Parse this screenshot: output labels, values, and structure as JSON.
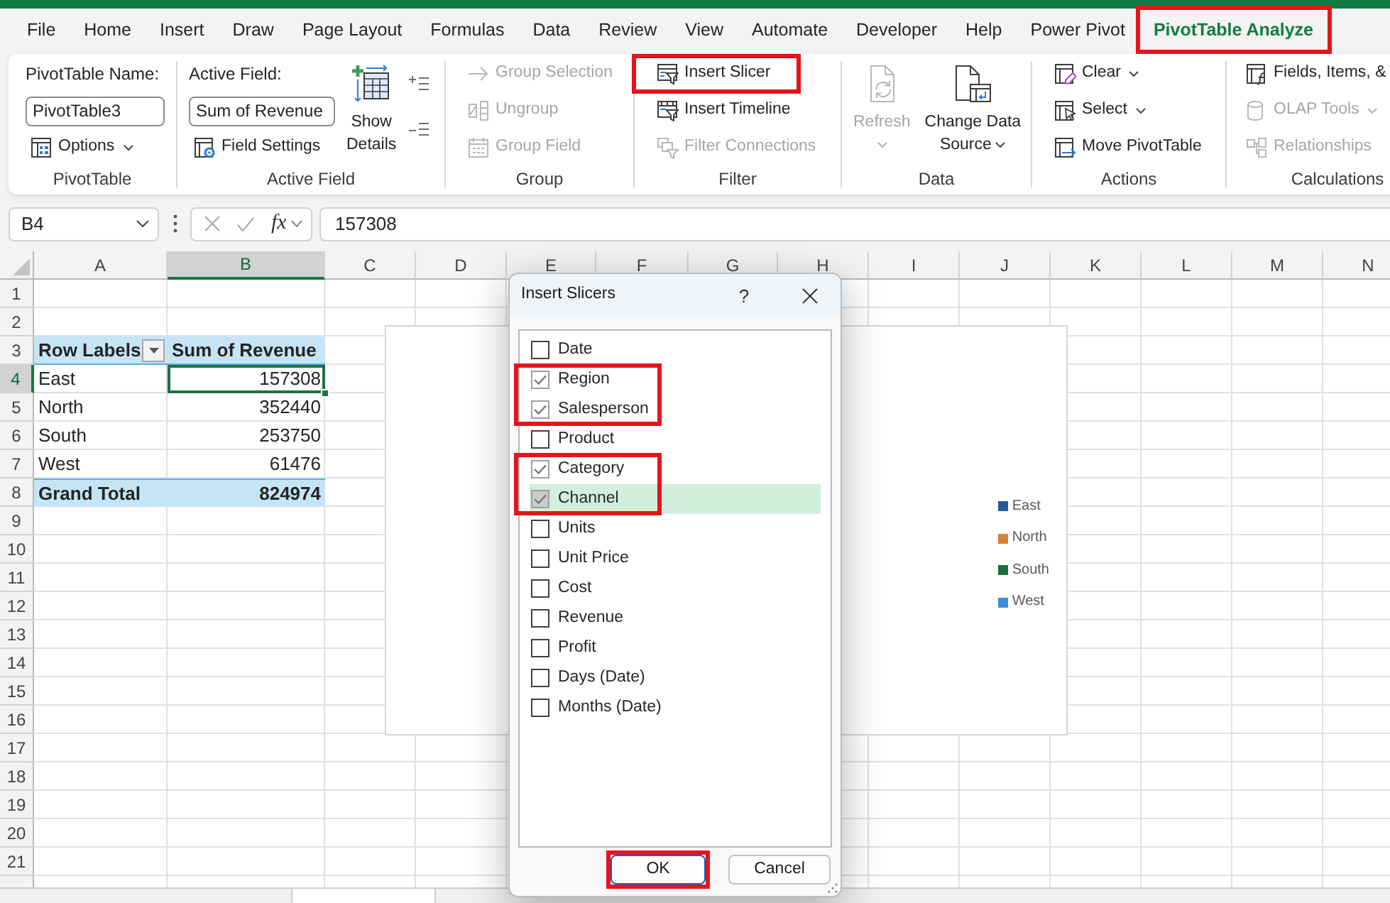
{
  "menu_tabs": [
    {
      "label": "File",
      "selected": false,
      "highlighted": false
    },
    {
      "label": "Home",
      "selected": false,
      "highlighted": false
    },
    {
      "label": "Insert",
      "selected": false,
      "highlighted": false
    },
    {
      "label": "Draw",
      "selected": false,
      "highlighted": false
    },
    {
      "label": "Page Layout",
      "selected": false,
      "highlighted": false
    },
    {
      "label": "Formulas",
      "selected": false,
      "highlighted": false
    },
    {
      "label": "Data",
      "selected": false,
      "highlighted": false
    },
    {
      "label": "Review",
      "selected": false,
      "highlighted": false
    },
    {
      "label": "View",
      "selected": false,
      "highlighted": false
    },
    {
      "label": "Automate",
      "selected": false,
      "highlighted": false
    },
    {
      "label": "Developer",
      "selected": false,
      "highlighted": false
    },
    {
      "label": "Help",
      "selected": false,
      "highlighted": false
    },
    {
      "label": "Power Pivot",
      "selected": false,
      "highlighted": false
    },
    {
      "label": "PivotTable Analyze",
      "selected": true,
      "highlighted": true
    }
  ],
  "ribbon": {
    "groups": [
      {
        "label": "PivotTable",
        "columns": [
          [
            {
              "kind": "field",
              "label": "PivotTable Name:",
              "value": "PivotTable3",
              "disabled": false,
              "highlighted": false
            },
            {
              "kind": "small",
              "label": "Options",
              "dropdown": true,
              "disabled": false,
              "highlighted": false
            }
          ]
        ]
      },
      {
        "label": "Active Field",
        "columns": [
          [
            {
              "kind": "field",
              "label": "Active Field:",
              "value": "Sum of Revenue",
              "disabled": false,
              "highlighted": false
            },
            {
              "kind": "small",
              "label": "Field Settings",
              "dropdown": false,
              "disabled": false,
              "highlighted": false
            }
          ],
          [
            {
              "kind": "large",
              "lines": [
                "Show",
                "Details"
              ],
              "dropdown": false,
              "disabled": false,
              "highlighted": false
            }
          ],
          [
            {
              "kind": "icon",
              "disabled": false,
              "highlighted": false
            },
            {
              "kind": "icon",
              "disabled": false,
              "highlighted": false
            }
          ]
        ]
      },
      {
        "label": "Group",
        "columns": [
          [
            {
              "kind": "small",
              "label": "Group Selection",
              "dropdown": false,
              "disabled": true,
              "highlighted": false
            },
            {
              "kind": "small",
              "label": "Ungroup",
              "dropdown": false,
              "disabled": true,
              "highlighted": false
            },
            {
              "kind": "small",
              "label": "Group Field",
              "dropdown": false,
              "disabled": true,
              "highlighted": false
            }
          ]
        ]
      },
      {
        "label": "Filter",
        "columns": [
          [
            {
              "kind": "small",
              "label": "Insert Slicer",
              "dropdown": false,
              "disabled": false,
              "highlighted": true
            },
            {
              "kind": "small",
              "label": "Insert Timeline",
              "dropdown": false,
              "disabled": false,
              "highlighted": false
            },
            {
              "kind": "small",
              "label": "Filter Connections",
              "dropdown": false,
              "disabled": true,
              "highlighted": false
            }
          ]
        ]
      },
      {
        "label": "Data",
        "columns": [
          [
            {
              "kind": "large",
              "lines": [
                "Refresh"
              ],
              "dropdown": true,
              "disabled": true,
              "highlighted": false
            }
          ],
          [
            {
              "kind": "large",
              "lines": [
                "Change Data",
                "Source"
              ],
              "dropdown": true,
              "disabled": false,
              "highlighted": false
            }
          ]
        ]
      },
      {
        "label": "Actions",
        "columns": [
          [
            {
              "kind": "small",
              "label": "Clear",
              "dropdown": true,
              "disabled": false,
              "highlighted": false
            },
            {
              "kind": "small",
              "label": "Select",
              "dropdown": true,
              "disabled": false,
              "highlighted": false
            },
            {
              "kind": "small",
              "label": "Move PivotTable",
              "dropdown": false,
              "disabled": false,
              "highlighted": false
            }
          ]
        ]
      },
      {
        "label": "Calculations",
        "columns": [
          [
            {
              "kind": "small",
              "label": "Fields, Items, &",
              "dropdown": false,
              "disabled": false,
              "highlighted": false
            },
            {
              "kind": "small",
              "label": "OLAP Tools",
              "dropdown": true,
              "disabled": true,
              "highlighted": false
            },
            {
              "kind": "small",
              "label": "Relationships",
              "dropdown": false,
              "disabled": true,
              "highlighted": false
            }
          ]
        ]
      }
    ]
  },
  "formula_bar": {
    "name_box": "B4",
    "function_button": "fx",
    "value": "157308"
  },
  "sheet": {
    "columns": [
      {
        "label": "A",
        "selected": false
      },
      {
        "label": "B",
        "selected": true
      },
      {
        "label": "C",
        "selected": false
      },
      {
        "label": "D",
        "selected": false
      },
      {
        "label": "E",
        "selected": false
      },
      {
        "label": "F",
        "selected": false
      },
      {
        "label": "G",
        "selected": false
      },
      {
        "label": "H",
        "selected": false
      },
      {
        "label": "I",
        "selected": false
      },
      {
        "label": "J",
        "selected": false
      },
      {
        "label": "K",
        "selected": false
      },
      {
        "label": "L",
        "selected": false
      },
      {
        "label": "M",
        "selected": false
      },
      {
        "label": "N",
        "selected": false
      }
    ],
    "rows": [
      {
        "label": "1",
        "selected": false
      },
      {
        "label": "2",
        "selected": false
      },
      {
        "label": "3",
        "selected": false
      },
      {
        "label": "4",
        "selected": true
      },
      {
        "label": "5",
        "selected": false
      },
      {
        "label": "6",
        "selected": false
      },
      {
        "label": "7",
        "selected": false
      },
      {
        "label": "8",
        "selected": false
      },
      {
        "label": "9",
        "selected": false
      },
      {
        "label": "10",
        "selected": false
      },
      {
        "label": "11",
        "selected": false
      },
      {
        "label": "12",
        "selected": false
      },
      {
        "label": "13",
        "selected": false
      },
      {
        "label": "14",
        "selected": false
      },
      {
        "label": "15",
        "selected": false
      },
      {
        "label": "16",
        "selected": false
      },
      {
        "label": "17",
        "selected": false
      },
      {
        "label": "18",
        "selected": false
      },
      {
        "label": "19",
        "selected": false
      },
      {
        "label": "20",
        "selected": false
      },
      {
        "label": "21",
        "selected": false
      }
    ],
    "pivot": {
      "header": [
        "Row Labels",
        "Sum of Revenue"
      ],
      "rows": [
        {
          "label": "East",
          "value": "157308",
          "selected": true
        },
        {
          "label": "North",
          "value": "352440",
          "selected": false
        },
        {
          "label": "South",
          "value": "253750",
          "selected": false
        },
        {
          "label": "West",
          "value": "61476",
          "selected": false
        }
      ],
      "total": {
        "label": "Grand Total",
        "value": "824974"
      }
    }
  },
  "chart": {
    "legend": [
      {
        "label": "East",
        "color": "#1f5c99"
      },
      {
        "label": "North",
        "color": "#d6833a"
      },
      {
        "label": "South",
        "color": "#17703d"
      },
      {
        "label": "West",
        "color": "#3a8fd8"
      }
    ]
  },
  "dialog": {
    "title": "Insert Slicers",
    "help": "?",
    "fields": [
      {
        "label": "Date",
        "checked": false,
        "selected": false,
        "highlighted": false
      },
      {
        "label": "Region",
        "checked": true,
        "selected": false,
        "highlighted": true
      },
      {
        "label": "Salesperson",
        "checked": true,
        "selected": false,
        "highlighted": true
      },
      {
        "label": "Product",
        "checked": false,
        "selected": false,
        "highlighted": false
      },
      {
        "label": "Category",
        "checked": true,
        "selected": false,
        "highlighted": true
      },
      {
        "label": "Channel",
        "checked": true,
        "selected": true,
        "highlighted": true
      },
      {
        "label": "Units",
        "checked": false,
        "selected": false,
        "highlighted": false
      },
      {
        "label": "Unit Price",
        "checked": false,
        "selected": false,
        "highlighted": false
      },
      {
        "label": "Cost",
        "checked": false,
        "selected": false,
        "highlighted": false
      },
      {
        "label": "Revenue",
        "checked": false,
        "selected": false,
        "highlighted": false
      },
      {
        "label": "Profit",
        "checked": false,
        "selected": false,
        "highlighted": false
      },
      {
        "label": "Days (Date)",
        "checked": false,
        "selected": false,
        "highlighted": false
      },
      {
        "label": "Months (Date)",
        "checked": false,
        "selected": false,
        "highlighted": false
      }
    ],
    "buttons": [
      {
        "label": "OK",
        "default": true,
        "highlighted": true
      },
      {
        "label": "Cancel",
        "default": false,
        "highlighted": false
      }
    ]
  }
}
